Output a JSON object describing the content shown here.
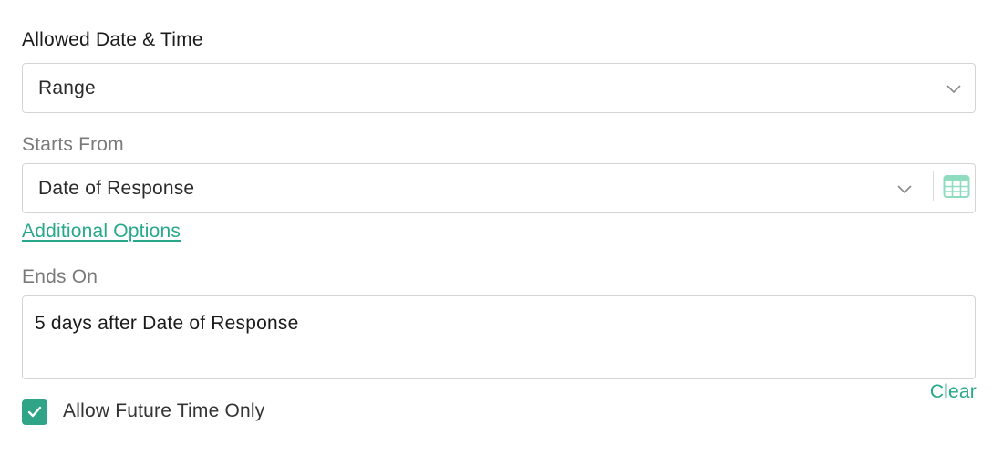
{
  "allowed": {
    "label": "Allowed Date & Time",
    "selected": "Range",
    "icon": "chevron-down-icon"
  },
  "starts_from": {
    "label": "Starts From",
    "selected": "Date of Response",
    "dropdown_icon": "chevron-down-icon",
    "calendar_icon": "calendar-icon"
  },
  "additional_options": {
    "label": "Additional Options"
  },
  "ends_on": {
    "label": "Ends On",
    "value": "5 days after Date of Response",
    "clear_label": "Clear"
  },
  "future_only": {
    "label": "Allow Future Time Only",
    "checked": true
  },
  "colors": {
    "accent": "#27a88a",
    "checkbox": "#2fa486",
    "calendar": "#8fdcc0",
    "border": "#d4d4d4"
  }
}
